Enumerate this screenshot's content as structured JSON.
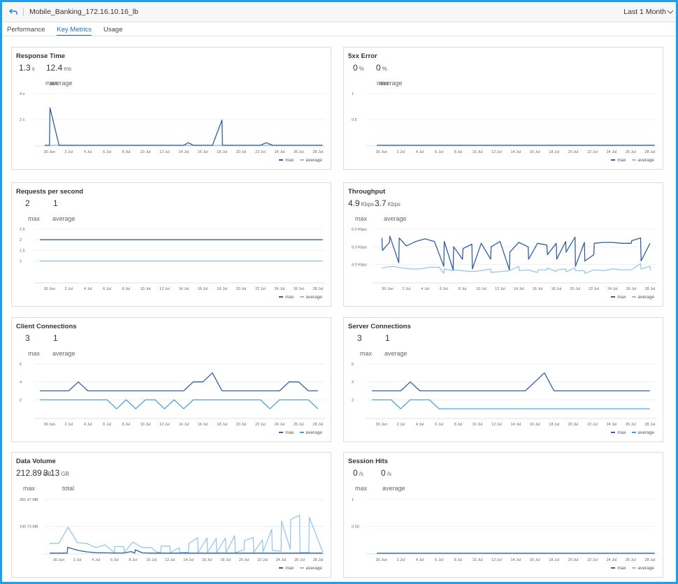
{
  "header": {
    "title": "Mobile_Banking_172.16.10.16_lb",
    "time_range": "Last 1 Month"
  },
  "tabs": [
    {
      "label": "Performance",
      "active": false
    },
    {
      "label": "Key Metrics",
      "active": true
    },
    {
      "label": "Usage",
      "active": false
    }
  ],
  "colors": {
    "max": "#2f5f9e",
    "average": "#8cc4ef",
    "average_strong": "#3d9be0",
    "grid": "#f0f0f0",
    "axis": "#dde3ea"
  },
  "legend": {
    "max": "max",
    "average": "average"
  },
  "x_ticks": [
    "30 Jun",
    "2 Jul",
    "4 Jul",
    "6 Jul",
    "8 Jul",
    "10 Jul",
    "12 Jul",
    "14 Jul",
    "16 Jul",
    "18 Jul",
    "20 Jul",
    "22 Jul",
    "24 Jul",
    "26 Jul",
    "28 Jul"
  ],
  "cards": [
    {
      "id": "response-time",
      "title": "Response Time",
      "stats": [
        {
          "value": "1.3",
          "unit": "s",
          "label": "max"
        },
        {
          "value": "12.4",
          "unit": "ms",
          "label": "average"
        }
      ]
    },
    {
      "id": "5xx-error",
      "title": "5xx Error",
      "stats": [
        {
          "value": "0",
          "unit": "%",
          "label": "max"
        },
        {
          "value": "0",
          "unit": "%",
          "label": "average"
        }
      ]
    },
    {
      "id": "requests-per-second",
      "title": "Requests per second",
      "stats": [
        {
          "value": "2",
          "unit": "",
          "label": "max"
        },
        {
          "value": "1",
          "unit": "",
          "label": "average"
        }
      ]
    },
    {
      "id": "throughput",
      "title": "Throughput",
      "stats": [
        {
          "value": "4.9",
          "unit": "Kbps",
          "label": "max"
        },
        {
          "value": "3.7",
          "unit": "Kbps",
          "label": "average"
        }
      ]
    },
    {
      "id": "client-connections",
      "title": "Client Connections",
      "stats": [
        {
          "value": "3",
          "unit": "",
          "label": "max"
        },
        {
          "value": "1",
          "unit": "",
          "label": "average"
        }
      ]
    },
    {
      "id": "server-connections",
      "title": "Server Connections",
      "stats": [
        {
          "value": "3",
          "unit": "",
          "label": "max"
        },
        {
          "value": "1",
          "unit": "",
          "label": "average"
        }
      ]
    },
    {
      "id": "data-volume",
      "title": "Data Volume",
      "stats": [
        {
          "value": "212.89",
          "unit": "MB",
          "label": "max"
        },
        {
          "value": "3.13",
          "unit": "GB",
          "label": "total"
        }
      ]
    },
    {
      "id": "session-hits",
      "title": "Session Hits",
      "stats": [
        {
          "value": "0",
          "unit": "/s",
          "label": "max"
        },
        {
          "value": "0",
          "unit": "/s",
          "label": "average"
        }
      ]
    }
  ],
  "chart_data": [
    {
      "type": "line",
      "title": "Response Time",
      "ylim": [
        0,
        4
      ],
      "y_ticks": [
        {
          "v": 4,
          "label": "4 s"
        },
        {
          "v": 2,
          "label": "2 s"
        }
      ],
      "x": [
        -0.5,
        0,
        0.05,
        1,
        14,
        14.5,
        15,
        15.5,
        17,
        18,
        18.05,
        22,
        22.6,
        23.3,
        28.5
      ],
      "series": [
        {
          "name": "max",
          "values": [
            0,
            0,
            2.9,
            0,
            0,
            0.2,
            0,
            0,
            0,
            1.95,
            0,
            0,
            0.2,
            0,
            0
          ]
        },
        {
          "name": "average",
          "values": [
            0,
            0,
            0,
            0,
            0,
            0,
            0,
            0,
            0,
            0,
            0,
            0,
            0,
            0,
            0
          ]
        }
      ]
    },
    {
      "type": "line",
      "title": "5xx Error",
      "ylim": [
        0,
        1
      ],
      "y_ticks": [
        {
          "v": 1,
          "label": "1"
        },
        {
          "v": 0.5,
          "label": "0.5"
        }
      ],
      "x": [
        -0.5,
        28.5
      ],
      "series": [
        {
          "name": "max",
          "values": [
            0,
            0
          ]
        },
        {
          "name": "average",
          "values": [
            0,
            0
          ]
        }
      ]
    },
    {
      "type": "line",
      "title": "Requests per second",
      "ylim": [
        0,
        2.5
      ],
      "y_ticks": [
        {
          "v": 2.5,
          "label": "2.5"
        },
        {
          "v": 2,
          "label": "2"
        },
        {
          "v": 1.5,
          "label": "1.5"
        },
        {
          "v": 1,
          "label": "1"
        }
      ],
      "x": [
        -1,
        28.5
      ],
      "series": [
        {
          "name": "max",
          "values": [
            2,
            2
          ]
        },
        {
          "name": "average",
          "values": [
            1,
            1
          ]
        }
      ]
    },
    {
      "type": "line",
      "title": "Throughput",
      "ylim": [
        3,
        6
      ],
      "y_ticks": [
        {
          "v": 6,
          "label": "6.0 Kbps"
        },
        {
          "v": 5,
          "label": "5.0 Kbps"
        },
        {
          "v": 4,
          "label": "4.0 Kbps"
        }
      ],
      "series": [
        {
          "name": "max",
          "x": [
            -0.6,
            -0.55,
            0.2,
            0.25,
            1.2,
            1.25,
            2,
            3,
            4,
            5,
            6,
            6.05,
            7,
            7.05,
            8,
            8.05,
            9,
            9.05,
            10,
            11,
            11.05,
            12,
            13,
            13.05,
            14,
            15,
            15.05,
            16,
            17,
            17.05,
            18,
            18.05,
            19,
            19.05,
            20,
            20.05,
            21,
            21.05,
            22,
            22.05,
            23,
            24,
            25,
            26,
            26.05,
            27,
            27.05,
            28
          ],
          "values": [
            5.5,
            4.8,
            5.25,
            5.6,
            4.1,
            5.5,
            5.05,
            5.3,
            5.45,
            5.3,
            3.9,
            5.3,
            3.7,
            5.0,
            4.3,
            4.9,
            5.15,
            3.75,
            5.2,
            4.3,
            5.0,
            5.3,
            3.7,
            4.7,
            5.25,
            5.0,
            4.3,
            5.2,
            5.1,
            4.55,
            5.2,
            4.3,
            5.3,
            4.7,
            5.55,
            3.9,
            5.25,
            4.2,
            4.55,
            5.2,
            5.25,
            5.25,
            5.2,
            5.2,
            5.35,
            5.5,
            4.2,
            5.2
          ]
        },
        {
          "name": "average",
          "x": [
            -0.6,
            0.5,
            1.5,
            2.5,
            3.5,
            4.5,
            5.5,
            6,
            6.05,
            7,
            7.05,
            8,
            9,
            10,
            11,
            11.05,
            12,
            13,
            14,
            14.05,
            15,
            16,
            16.05,
            17,
            17.05,
            18,
            18.05,
            19,
            19.05,
            20,
            20.05,
            21,
            21.05,
            22,
            23,
            24,
            25,
            26,
            27,
            27.05,
            28,
            28.05
          ],
          "values": [
            3.8,
            3.9,
            3.8,
            3.75,
            3.75,
            3.85,
            3.85,
            3.5,
            3.75,
            3.65,
            3.7,
            3.65,
            3.6,
            3.65,
            3.75,
            3.55,
            3.6,
            3.65,
            3.9,
            3.65,
            3.7,
            3.55,
            3.7,
            3.7,
            3.8,
            3.6,
            3.7,
            3.75,
            3.6,
            3.8,
            3.65,
            3.65,
            3.5,
            3.7,
            3.65,
            3.75,
            3.7,
            3.7,
            4.05,
            3.75,
            3.9,
            3.65
          ]
        }
      ]
    },
    {
      "type": "line",
      "title": "Client Connections",
      "ylim": [
        0,
        6
      ],
      "y_ticks": [
        {
          "v": 6,
          "label": "6"
        },
        {
          "v": 4,
          "label": "4"
        },
        {
          "v": 2,
          "label": "2"
        }
      ],
      "x": [
        -1,
        0,
        1,
        2,
        3,
        4,
        5,
        6,
        7,
        8,
        9,
        10,
        11,
        12,
        13,
        14,
        15,
        16,
        17,
        18,
        19,
        20,
        21,
        22,
        23,
        24,
        25,
        26,
        27,
        28
      ],
      "series": [
        {
          "name": "max",
          "values": [
            3,
            3,
            3,
            3,
            4,
            3,
            3,
            3,
            3,
            3,
            3,
            3,
            3,
            3,
            3,
            3,
            4,
            4,
            5,
            3,
            3,
            3,
            3,
            3,
            3,
            3,
            4,
            4,
            3,
            3
          ]
        },
        {
          "name": "average",
          "values": [
            2,
            2,
            2,
            2,
            2,
            2,
            2,
            2,
            1,
            2,
            1,
            2,
            2,
            1,
            2,
            1,
            2,
            2,
            2,
            2,
            2,
            2,
            2,
            2,
            1,
            2,
            2,
            2,
            2,
            1
          ]
        }
      ]
    },
    {
      "type": "line",
      "title": "Server Connections",
      "ylim": [
        0,
        6
      ],
      "y_ticks": [
        {
          "v": 6,
          "label": "6"
        },
        {
          "v": 4,
          "label": "4"
        },
        {
          "v": 2,
          "label": "2"
        }
      ],
      "x": [
        -1,
        0,
        1,
        2,
        3,
        4,
        5,
        6,
        7,
        8,
        9,
        10,
        11,
        12,
        13,
        14,
        15,
        16,
        17,
        18,
        19,
        20,
        21,
        22,
        23,
        24,
        25,
        26,
        27,
        28
      ],
      "series": [
        {
          "name": "max",
          "values": [
            3,
            3,
            3,
            3,
            4,
            3,
            3,
            3,
            3,
            3,
            3,
            3,
            3,
            3,
            3,
            3,
            3,
            4,
            5,
            3,
            3,
            3,
            3,
            3,
            3,
            3,
            3,
            3,
            3,
            3
          ]
        },
        {
          "name": "average",
          "values": [
            2,
            2,
            2,
            1,
            2,
            2,
            2,
            1,
            1,
            1,
            1,
            1,
            1,
            1,
            1,
            1,
            1,
            1,
            1,
            1,
            1,
            1,
            1,
            1,
            1,
            1,
            1,
            1,
            1,
            1
          ]
        }
      ]
    },
    {
      "type": "line",
      "title": "Data Volume",
      "ylim": [
        0,
        381.47
      ],
      "y_ticks": [
        {
          "v": 381.47,
          "label": "381.47 MB"
        },
        {
          "v": 190.73,
          "label": "190.73 MB"
        }
      ],
      "series": [
        {
          "name": "max",
          "x": [
            -1,
            0.9,
            0.95,
            2,
            3,
            4,
            5,
            6,
            7,
            7.8,
            8.2,
            8.25,
            9,
            10,
            28.5
          ],
          "values": [
            1,
            1,
            42,
            22,
            10,
            4,
            3,
            2,
            2,
            12,
            1,
            25,
            3,
            1,
            1
          ]
        },
        {
          "name": "average",
          "x": [
            -1,
            0,
            1,
            2,
            3,
            4,
            5,
            6,
            6.05,
            7,
            7.05,
            8,
            9,
            10,
            10.5,
            11,
            11.05,
            12,
            12.05,
            13,
            13.05,
            14,
            14.05,
            15,
            15.05,
            16,
            16.05,
            17,
            17.05,
            18,
            18.05,
            19,
            19.05,
            20,
            20.05,
            21,
            21.05,
            22,
            22.05,
            23,
            23.05,
            24,
            24.05,
            25,
            25.05,
            26,
            26.05,
            27,
            27.05,
            28.5
          ],
          "values": [
            70,
            70,
            185,
            75,
            70,
            40,
            60,
            5,
            48,
            48,
            5,
            80,
            40,
            40,
            10,
            5,
            50,
            50,
            5,
            40,
            5,
            8,
            70,
            110,
            5,
            108,
            5,
            105,
            5,
            108,
            5,
            125,
            5,
            22,
            90,
            112,
            5,
            95,
            10,
            170,
            20,
            15,
            230,
            30,
            240,
            270,
            5,
            5,
            255,
            10
          ]
        }
      ]
    },
    {
      "type": "line",
      "title": "Session Hits",
      "ylim": [
        0,
        1
      ],
      "y_ticks": [
        {
          "v": 1,
          "label": "1"
        },
        {
          "v": 0.5,
          "label": "0.50"
        }
      ],
      "x": [
        -0.5,
        28.5
      ],
      "series": [
        {
          "name": "max",
          "values": [
            0,
            0
          ]
        },
        {
          "name": "average",
          "values": [
            0,
            0
          ]
        }
      ]
    }
  ]
}
